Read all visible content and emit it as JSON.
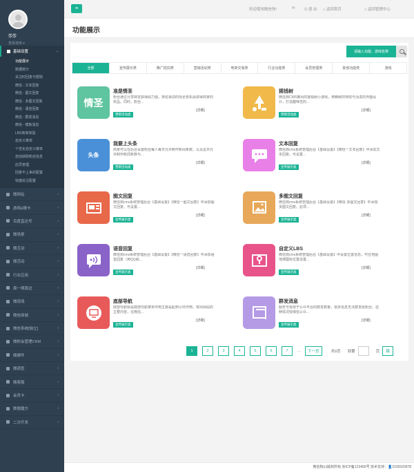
{
  "sidebar": {
    "profile": {
      "name": "莎莎",
      "role": "查看使用 ▾"
    },
    "active_group": "基础设置",
    "sub_items": [
      "功能展示",
      "数据统计",
      "关注时回复与帮助",
      "微信 - 文本回复",
      "微信 - 图文回复",
      "微信 - 多图文回复",
      "微信 - 语音回复",
      "微信 - 群发消息",
      "微信 - 模板消息",
      "LBS商家体验",
      "自定义菜单",
      "个性化自定义菜单",
      "自动获取粉丝信息",
      "店员管理",
      "回答不上来的配置",
      "快捷关注配置"
    ],
    "items": [
      "微网站",
      "游戏&微卡",
      "百度直达号",
      "微场景",
      "微互动",
      "微活动",
      "行业应用",
      "周一嘀周边",
      "微现场",
      "微信商城",
      "微信系统[独立]",
      "微粉会管理CRM",
      "微硬件",
      "微调查",
      "微客服",
      "会员卡",
      "数据魔方",
      "二次开发"
    ]
  },
  "topbar": {
    "menu_icon": "≡",
    "welcome": "欢迎使用微信狗!",
    "logout": "退 出",
    "home": "返回首页",
    "admin": "返回管理中心"
  },
  "page": {
    "title": "功能展示"
  },
  "search": {
    "button": "请输入功能、游戏名称"
  },
  "tabs": [
    "全部",
    "宣传展示类",
    "推广抵扣类",
    "营销活动类",
    "电商交易类",
    "行业功能类",
    "会员管理类",
    "其他功能类",
    "游戏"
  ],
  "cards": [
    {
      "title": "准是情圣",
      "desc": "粉丝通过分享转发获得助力值，排名靠前的情圣有机会获得商家的奖品。同时，粉丝...",
      "tag": "营销活动类",
      "detail": "[详细]",
      "color": "#5fc4a0",
      "icon": "qingsheng-icon",
      "glyph": "情圣"
    },
    {
      "title": "摇钱树",
      "desc": "微信狗CMS推出的摇钱树小游戏，用精致的特效与活泼的界面设计，打造趣味性的...",
      "tag": "营销活动类",
      "detail": "[详细]",
      "color": "#f0b94a",
      "icon": "money-tree-icon",
      "glyph": ""
    },
    {
      "title": "我要上头条",
      "desc": "商家可以在后台设置粉丝每人每天允许制作新闻条数，以及总共允许制作新闻条数与...",
      "tag": "营销活动类",
      "detail": "[详细]",
      "color": "#4a90d9",
      "icon": "headline-tag-icon",
      "glyph": "头条"
    },
    {
      "title": "文本回复",
      "desc": "微信狗cms系统管理后台【基础设置】【微信一文本回复】中添加文本回复。可设置...",
      "tag": "宣传展示类",
      "detail": "[详细]",
      "color": "#e980e8",
      "icon": "chat-bubble-icon",
      "glyph": ""
    },
    {
      "title": "图文回复",
      "desc": "微信狗cms系统管理后台【基础设置】【微信一图文回复】中添加图文回复。可设置...",
      "tag": "宣传展示类",
      "detail": "[详细]",
      "color": "#e8684a",
      "icon": "news-icon",
      "glyph": ""
    },
    {
      "title": "多图文回复",
      "desc": "微信狗cms系统管理后台【基础设置】【微信-多图文回复】中添加多图文回复。此项...",
      "tag": "宣传展示类",
      "detail": "[详细]",
      "color": "#e8a85a",
      "icon": "gallery-icon",
      "glyph": ""
    },
    {
      "title": "语音回复",
      "desc": "微信狗cms系统管理后台【基础设置】【微信一语音回复】中添加语音回复（用QQ就...",
      "tag": "宣传展示类",
      "detail": "[详细]",
      "color": "#8a63c9",
      "icon": "voice-icon",
      "glyph": ""
    },
    {
      "title": "自定义LBS",
      "desc": "微信狗cms系统管理后台【基础设置】中设置位置信息，可在地图地搜图标位置设置...",
      "tag": "宣传展示类",
      "detail": "[详细]",
      "color": "#e8548a",
      "icon": "location-icon",
      "glyph": ""
    },
    {
      "title": "底部导航",
      "desc": "底部导航就是底部导航菜单作用主要是起到引导作用，突出网站的主要内容，在微信...",
      "tag": "宣传展示类",
      "detail": "[详细]",
      "color": "#e85a5a",
      "icon": "monitor-icon",
      "glyph": ""
    },
    {
      "title": "群发消息",
      "desc": "服务号受限于公众平台的群发数量，很多信息无法群发给粉丝，这种情况快得信公众...",
      "tag": "宣传展示类",
      "detail": "[详细]",
      "color": "#b59ae6",
      "icon": "message-icon",
      "glyph": ""
    }
  ],
  "pager": {
    "pages": [
      "1",
      "2",
      "3",
      "4",
      "5",
      "6",
      "7"
    ],
    "dots": "...",
    "next": "下一页",
    "total": "共9页",
    "goto": "到第",
    "page_unit": "页",
    "confirm": "跳"
  },
  "footer": {
    "text": "微信狗(c)版权所有 京ICP备123456号 技术支持：👤3105920978"
  }
}
